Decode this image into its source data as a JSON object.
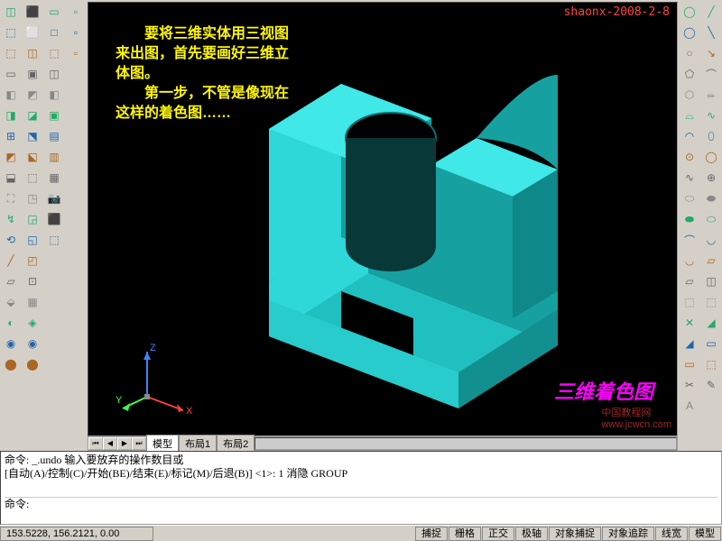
{
  "watermark": "shaonx-2008-2-8",
  "annotation": "　　要将三维实体用三视图来出图，首先要画好三维立体图。\n　　第一步，不管是像现在这样的着色图……",
  "label3d": "三维着色图",
  "watermark2": "中国教程网\nwww.jcwcn.com",
  "ucs": {
    "x": "X",
    "y": "Y",
    "z": "Z"
  },
  "tabs": {
    "model": "模型",
    "layout1": "布局1",
    "layout2": "布局2"
  },
  "cmd": {
    "line1": "命令: _.undo 输入要放弃的操作数目或",
    "line2": "[自动(A)/控制(C)/开始(BE)/结束(E)/标记(M)/后退(B)] <1>: 1 消隐 GROUP",
    "line3": "命令:"
  },
  "status": {
    "coords": "153.5228, 156.2121, 0.00",
    "snap": "捕捉",
    "grid": "栅格",
    "ortho": "正交",
    "polar": "极轴",
    "osnap": "对象捕捉",
    "otrack": "对象追踪",
    "lwt": "线宽",
    "model": "模型"
  },
  "tool_icons": {
    "l1": [
      "◫",
      "⬚",
      "⬚",
      "▭",
      "◧",
      "◨",
      "⊞",
      "◩",
      "⬓",
      "⛶",
      "↯",
      "⟲",
      "╱",
      "▱",
      "⬙",
      "◐",
      "◉",
      "⬤"
    ],
    "l2": [
      "⬛",
      "⬜",
      "◫",
      "▣",
      "◩",
      "◪",
      "⬔",
      "⬕",
      "⬚",
      "◳",
      "◲",
      "◱",
      "◰",
      "⊡",
      "▦",
      "◈",
      "◉",
      "⬤"
    ],
    "l3": [
      "▭",
      "□",
      "⬚",
      "◫",
      "◧",
      "▣",
      "▤",
      "▥",
      "▦",
      "📷",
      "⬛",
      "⬚",
      "",
      "",
      "",
      "",
      "",
      ""
    ],
    "l4": [
      "▫",
      "▫",
      "",
      "",
      "",
      "",
      "",
      "",
      "",
      "",
      "",
      "",
      "",
      "",
      "",
      "",
      "",
      ""
    ],
    "r1": [
      "◯",
      "◯",
      "○",
      "⬠",
      "⬡",
      "⌓",
      "◠",
      "⊙",
      "∿",
      "⬭",
      "⬬",
      "⌒",
      "◡",
      "▱",
      "⬚",
      "✕",
      "◢",
      "▭",
      "✂",
      "A"
    ],
    "r2": [
      "╱",
      "╲",
      "↘",
      "⌒",
      "⬰",
      "∿",
      "⬯",
      "◯",
      "⊕",
      "⬬",
      "⬭",
      "◡",
      "▱",
      "◫",
      "⬚",
      "◢",
      "▭",
      "⬚",
      "✎",
      ""
    ]
  }
}
